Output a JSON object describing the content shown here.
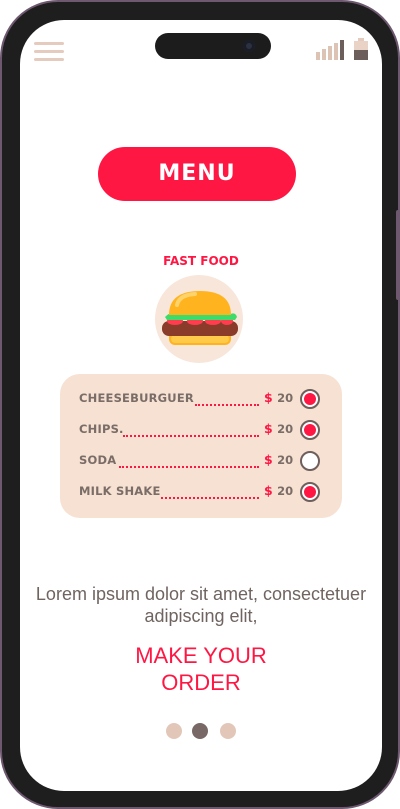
{
  "header": {
    "menu_icon": "hamburger-menu-icon",
    "signal_icon": "signal-bars-icon",
    "battery_icon": "battery-icon",
    "battery_level": 0.55
  },
  "main": {
    "menu_button_label": "MENU",
    "section_title": "FAST FOOD",
    "hero_icon": "burger-icon",
    "items": [
      {
        "name": "CHEESEBURGUER",
        "currency": "$",
        "price": "20",
        "selected": true
      },
      {
        "name": "CHIPS.",
        "currency": "$",
        "price": "20",
        "selected": true
      },
      {
        "name": "SODA",
        "currency": "$",
        "price": "20",
        "selected": false
      },
      {
        "name": "MILK SHAKE",
        "currency": "$",
        "price": "20",
        "selected": true
      }
    ],
    "description": "Lorem ipsum dolor sit amet, consectetuer adipiscing elit,",
    "cta_label": "MAKE YOUR ORDER"
  },
  "pager": {
    "count": 3,
    "active_index": 1
  },
  "colors": {
    "accent": "#ff1744",
    "card_bg": "#f6e1d3",
    "text_muted": "#7a6c66",
    "frame": "#6e5870"
  }
}
